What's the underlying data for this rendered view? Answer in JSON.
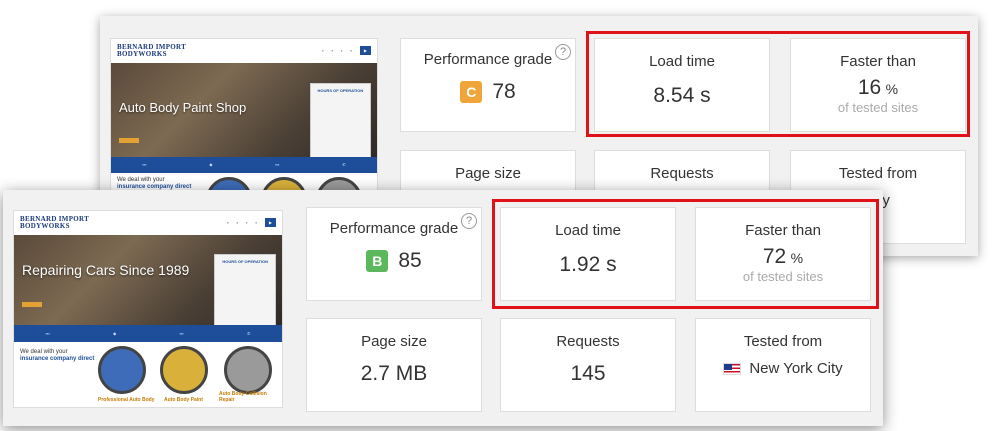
{
  "back": {
    "thumbnail": {
      "logo_line1": "BERNARD IMPORT",
      "logo_line2": "BODYWORKS",
      "hero_title": "Auto Body Paint Shop",
      "hours_title": "HOURS OF OPERATION",
      "below_text_1": "We deal with your",
      "below_text_2": "insurance company direct"
    },
    "performance": {
      "label": "Performance grade",
      "grade": "C",
      "grade_color": "#f0a53a",
      "score": "78"
    },
    "load_time": {
      "label": "Load time",
      "value": "8.54 s"
    },
    "faster_than": {
      "label": "Faster than",
      "value": "16",
      "unit": "%",
      "sub": "of tested sites"
    },
    "page_size": {
      "label": "Page size"
    },
    "requests": {
      "label": "Requests"
    },
    "tested_from": {
      "label": "Tested from",
      "city_partial": "ork City"
    }
  },
  "front": {
    "thumbnail": {
      "logo_line1": "BERNARD IMPORT",
      "logo_line2": "BODYWORKS",
      "hero_title": "Repairing Cars Since 1989",
      "hours_title": "HOURS OF OPERATION",
      "below_text_1": "We deal with your",
      "below_text_2": "insurance company direct",
      "caption_1": "Professional Auto Body",
      "caption_2": "Auto Body Paint",
      "caption_3": "Auto Body Collision Repair"
    },
    "performance": {
      "label": "Performance grade",
      "grade": "B",
      "grade_color": "#5cb85c",
      "score": "85"
    },
    "load_time": {
      "label": "Load time",
      "value": "1.92 s"
    },
    "faster_than": {
      "label": "Faster than",
      "value": "72",
      "unit": "%",
      "sub": "of tested sites"
    },
    "page_size": {
      "label": "Page size",
      "value": "2.7 MB"
    },
    "requests": {
      "label": "Requests",
      "value": "145"
    },
    "tested_from": {
      "label": "Tested from",
      "city": "New York City"
    }
  },
  "help_icon": "?",
  "highlight_color": "#e01218"
}
